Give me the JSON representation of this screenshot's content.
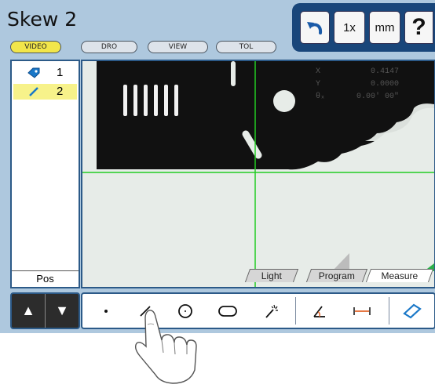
{
  "title": "Skew 2",
  "tabs": [
    "VIDEO",
    "DRO",
    "VIEW",
    "TOL"
  ],
  "active_tab": "VIDEO",
  "top_buttons": {
    "undo_icon": "undo-arrow-icon",
    "zoom": "1x",
    "units": "mm",
    "help": "?"
  },
  "features": [
    {
      "icon": "point-tag-icon",
      "number": "1",
      "selected": false
    },
    {
      "icon": "line-icon",
      "number": "2",
      "selected": true
    }
  ],
  "pos_label": "Pos",
  "readout": {
    "rows": [
      {
        "label": "X",
        "value": "0.4147"
      },
      {
        "label": "Y",
        "value": "0.0000"
      },
      {
        "label": "θₓ",
        "value": "0.00' 00\""
      }
    ]
  },
  "mode_tabs": [
    "Light",
    "Program",
    "Measure"
  ],
  "active_mode_tab": "Measure",
  "bottom_tools": [
    "point-icon",
    "line-icon",
    "circle-icon",
    "slot-icon",
    "magic-wand-icon",
    "angle-icon",
    "distance-icon",
    "skew-icon"
  ],
  "nav": {
    "up": "▲",
    "down": "▼"
  },
  "colors": {
    "accent_blue": "#19467a",
    "frame_blue": "#aec8de",
    "selected_yellow": "#f7f28a",
    "tab_active": "#f2e64a",
    "crosshair_green": "#22cc22"
  }
}
